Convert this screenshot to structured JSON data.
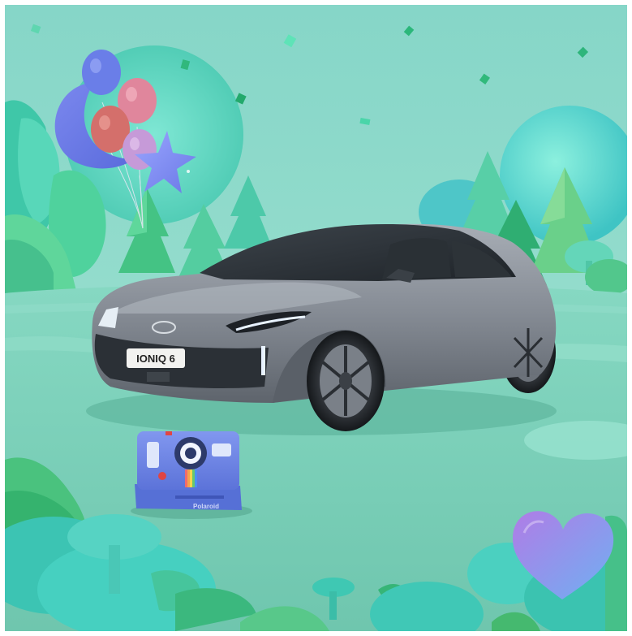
{
  "image": {
    "plate_text": "IONIQ 6",
    "camera_brand_text": "Polaroid"
  },
  "palette": {
    "sky_top": "#86d6c8",
    "sky_bottom": "#9ee0cf",
    "ground": "#7fd0bd",
    "ground_shadow": "#6cc2ad",
    "tree_light": "#5ed3a6",
    "tree_dark": "#2fb78a",
    "car_body": "#8d939c",
    "car_dark": "#2b3036",
    "balloon_blue": "#6a7ee8",
    "balloon_pink": "#e58aa2",
    "balloon_red": "#d9706f",
    "balloon_lilac": "#c69ad8",
    "camera_body": "#6f88e6",
    "heart_top": "#a07be0",
    "heart_bottom": "#7fa3f0"
  }
}
